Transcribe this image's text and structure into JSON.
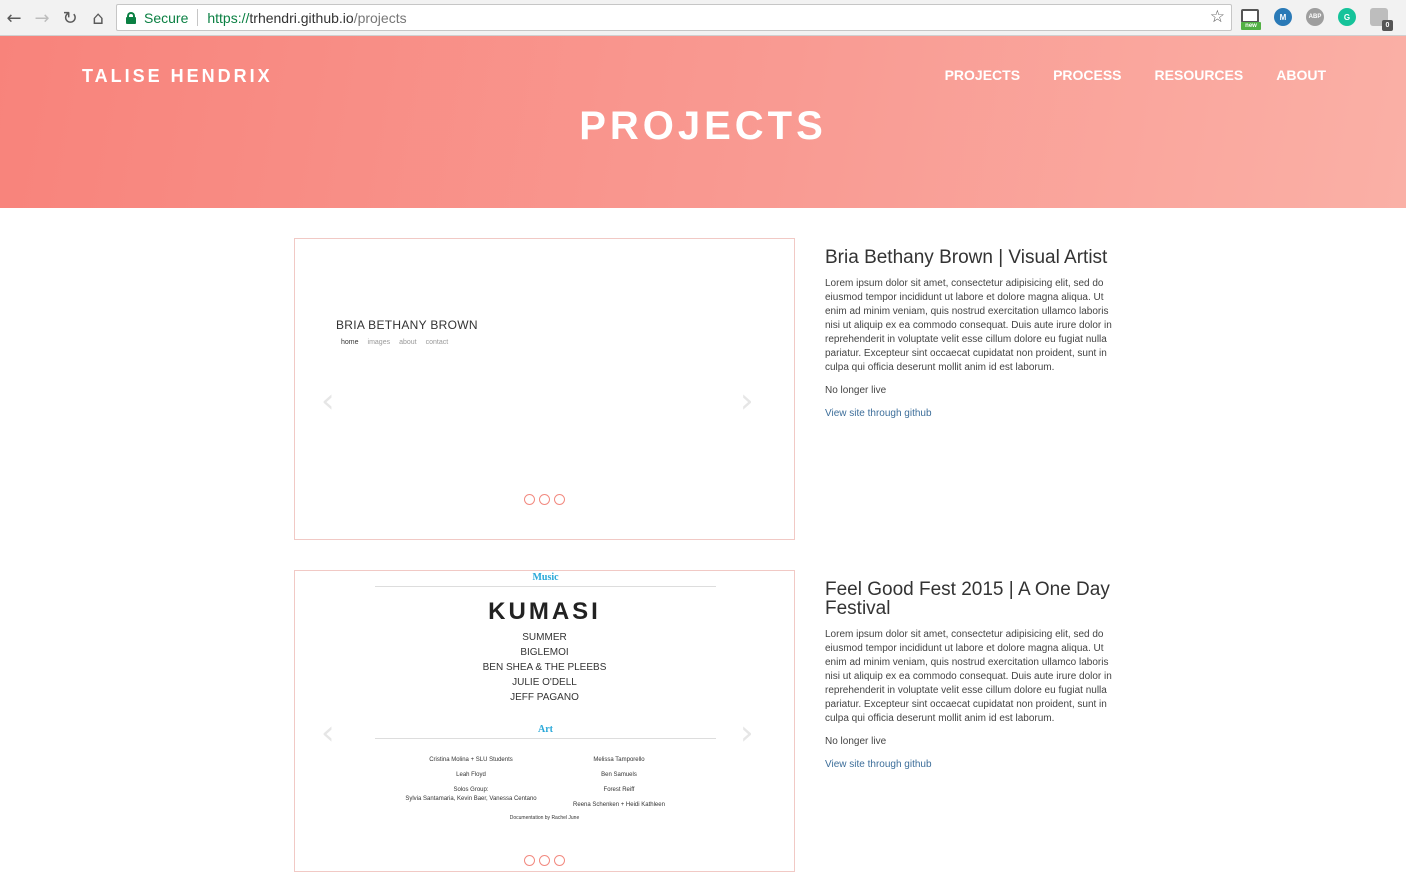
{
  "browser": {
    "secure_label": "Secure",
    "url_scheme": "https://",
    "url_host": "trhendri.github.io",
    "url_path": "/projects",
    "extensions": [
      "new",
      "M",
      "ABP",
      "G",
      "0"
    ]
  },
  "header": {
    "brand": "TALISE HENDRIX",
    "nav": [
      "PROJECTS",
      "PROCESS",
      "RESOURCES",
      "ABOUT"
    ],
    "title": "PROJECTS"
  },
  "projects": [
    {
      "title": "Bria Bethany Brown | Visual Artist",
      "description": "Lorem ipsum dolor sit amet, consectetur adipisicing elit, sed do eiusmod tempor incididunt ut labore et dolore magna aliqua. Ut enim ad minim veniam, quis nostrud exercitation ullamco laboris nisi ut aliquip ex ea commodo consequat. Duis aute irure dolor in reprehenderit in voluptate velit esse cillum dolore eu fugiat nulla pariatur. Excepteur sint occaecat cupidatat non proident, sunt in culpa qui officia deserunt mollit anim id est laborum.",
      "status": "No longer live",
      "link": "View site through github",
      "slide": {
        "brand": "BRIA BETHANY BROWN",
        "nav": [
          "home",
          "images",
          "about",
          "contact"
        ]
      }
    },
    {
      "title": "Feel Good Fest 2015 | A One Day Festival",
      "description": "Lorem ipsum dolor sit amet, consectetur adipisicing elit, sed do eiusmod tempor incididunt ut labore et dolore magna aliqua. Ut enim ad minim veniam, quis nostrud exercitation ullamco laboris nisi ut aliquip ex ea commodo consequat. Duis aute irure dolor in reprehenderit in voluptate velit esse cillum dolore eu fugiat nulla pariatur. Excepteur sint occaecat cupidatat non proident, sunt in culpa qui officia deserunt mollit anim id est laborum.",
      "status": "No longer live",
      "link": "View site through github",
      "slide": {
        "music_heading": "Music",
        "headliner": "KUMASI",
        "acts": [
          "SUMMER",
          "BIGLEMOI",
          "BEN SHEA & THE PLEEBS",
          "JULIE O'DELL",
          "JEFF PAGANO"
        ],
        "art_heading": "Art",
        "art_left": [
          "Cristina Molina + SLU Students",
          "Leah Floyd",
          "Solos Group:",
          "Sylvia Santamaria, Kevin Baer, Vanessa Centano"
        ],
        "art_right": [
          "Melissa Tamporello",
          "Ben Samuels",
          "Forest Reiff",
          "Reena Schenken + Heidi Kathleen"
        ],
        "documentation": "Documentation by Rachel June"
      }
    }
  ]
}
